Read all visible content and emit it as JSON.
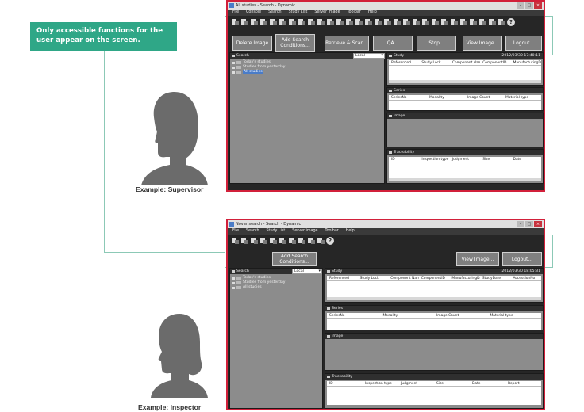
{
  "callout": {
    "text": "Only accessible functions for the user appear on the screen."
  },
  "captions": {
    "supervisor": "Example: Supervisor",
    "inspector": "Example: Inspector"
  },
  "colors": {
    "accent": "#2fa787",
    "frame_red": "#d2203a",
    "dark": "#262626",
    "panel": "#8c8c8c"
  },
  "supervisor": {
    "title": "All studies - Search - Dynamic",
    "menu": [
      "File",
      "Console",
      "Search",
      "Study List",
      "Server image",
      "Toolbar",
      "Help"
    ],
    "buttons": {
      "delete_image": "Delete Image",
      "add_search": "Add Search Conditions...",
      "retrieve_scan": "Retrieve & Scan...",
      "qa": "QA...",
      "stop": "Stop...",
      "view_image": "View Image...",
      "logout": "Logout..."
    },
    "search_panel": {
      "title": "Search",
      "source": "Local",
      "tree": [
        "Today's studies",
        "Studies from yesterday",
        "All studies"
      ]
    },
    "study": {
      "title": "Study",
      "timestamp": "2012/03/30 17:40:11",
      "columns": [
        "Referenced",
        "Study Lock",
        "Component Name",
        "ComponentID",
        "ManufacturingDa"
      ]
    },
    "series": {
      "title": "Series",
      "columns": [
        "SeriesNo",
        "Modality",
        "Image Count",
        "Material type"
      ]
    },
    "image": {
      "title": "Image"
    },
    "traceability": {
      "title": "Traceability",
      "columns": [
        "ID",
        "Inspection type",
        "Judgment",
        "Size",
        "Date"
      ]
    }
  },
  "inspector": {
    "title": "Novar search - Search - Dynamic",
    "menu": [
      "File",
      "Search",
      "Study List",
      "Server image",
      "Toolbar",
      "Help"
    ],
    "buttons": {
      "add_search": "Add Search Conditions...",
      "view_image": "View Image...",
      "logout": "Logout..."
    },
    "search_panel": {
      "title": "Search",
      "source": "Local",
      "tree": [
        "Today's studies",
        "Studies from yesterday",
        "All studies"
      ]
    },
    "study": {
      "title": "Study",
      "timestamp": "2012/03/30 18:05:31",
      "columns": [
        "Referenced",
        "Study Lock",
        "Component Name",
        "ComponentID",
        "ManufacturingDate",
        "StudyDate",
        "AccessionNo"
      ]
    },
    "series": {
      "title": "Series",
      "columns": [
        "SeriesNo",
        "Modality",
        "Image Count",
        "Material type"
      ]
    },
    "image": {
      "title": "Image"
    },
    "traceability": {
      "title": "Traceability",
      "columns": [
        "ID",
        "Inspection type",
        "Judgment",
        "Size",
        "Date",
        "Report"
      ]
    }
  }
}
